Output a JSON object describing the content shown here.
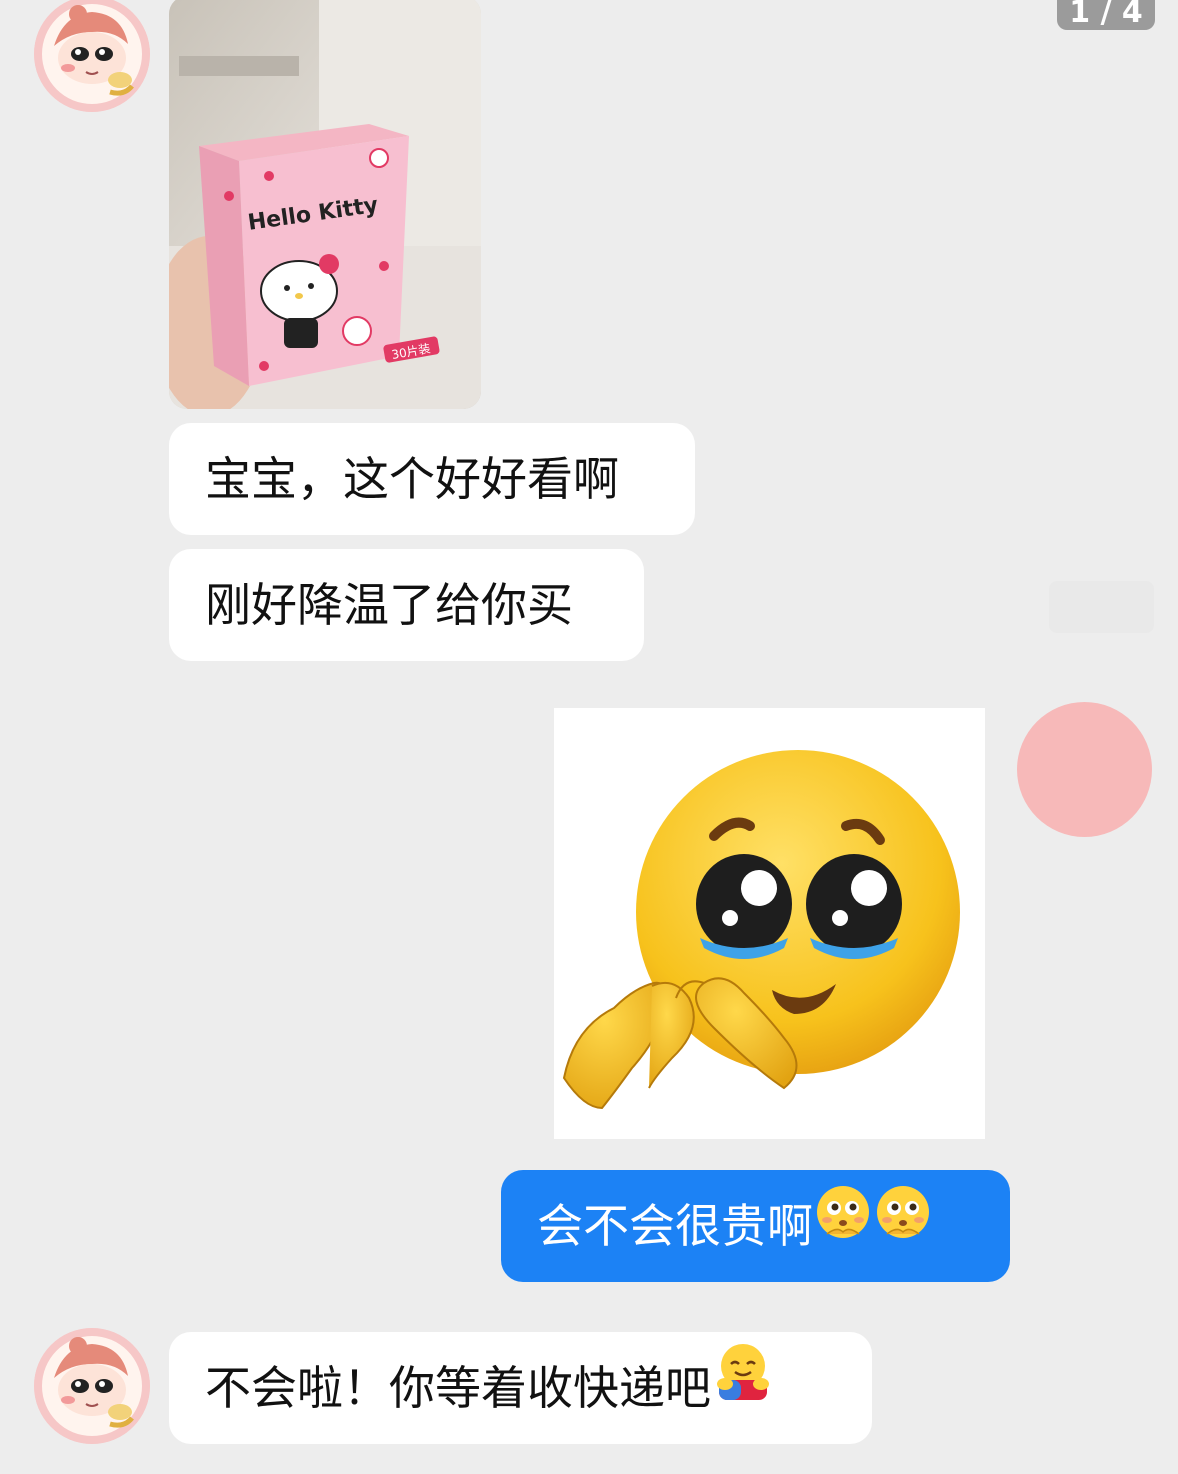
{
  "page_indicator": "1 / 4",
  "photo": {
    "brand_text": "Hello Kitty",
    "count_label": "30片装"
  },
  "messages": [
    {
      "text": "宝宝，这个好好看啊"
    },
    {
      "text": "刚好降温了给你买"
    },
    {
      "text": "会不会很贵啊",
      "emoji": [
        "thinking-blush-emoji",
        "thinking-blush-emoji"
      ]
    },
    {
      "text": "不会啦！你等着收快递吧",
      "emoji": [
        "hug-emoji"
      ]
    }
  ],
  "sticker": {
    "icon": "pleading-face-heart-hands"
  },
  "colors": {
    "background": "#ededed",
    "bubble_left": "#ffffff",
    "bubble_right": "#1c82f5",
    "avatar_pink": "#f7b9b9"
  }
}
